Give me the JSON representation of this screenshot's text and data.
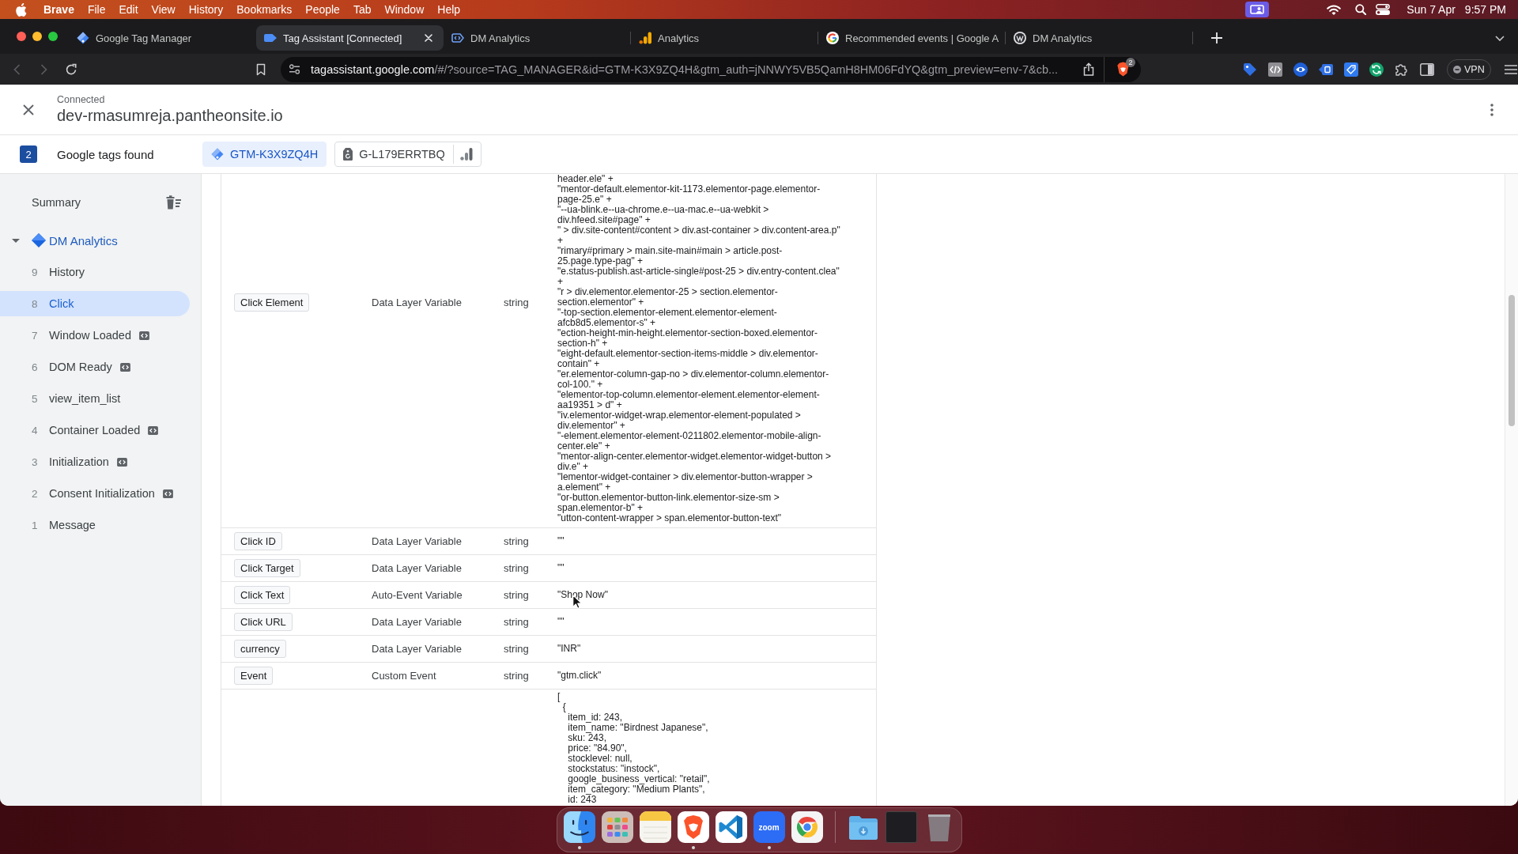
{
  "menu_bar": {
    "app_name": "Brave",
    "menus": [
      "File",
      "Edit",
      "View",
      "History",
      "Bookmarks",
      "People",
      "Tab",
      "Window",
      "Help"
    ],
    "date": "Sun 7 Apr",
    "time": "9:57 PM"
  },
  "browser": {
    "tabs": [
      {
        "title": "Google Tag Manager",
        "kind": "gtm",
        "selected": false
      },
      {
        "title": "Tag Assistant [Connected]",
        "kind": "tag_assistant",
        "selected": true
      },
      {
        "title": "DM Analytics",
        "kind": "tag_outline",
        "selected": false
      },
      {
        "title": "Analytics",
        "kind": "analytics",
        "selected": false
      },
      {
        "title": "Recommended events | Google A",
        "kind": "google",
        "selected": false
      },
      {
        "title": "DM Analytics",
        "kind": "wordpress",
        "selected": false
      }
    ],
    "address_bar": {
      "host": "tagassistant.google.com",
      "path": "/#/?source=TAG_MANAGER&id=GTM-K3X9ZQ4H&gtm_auth=jNNWY5VB5QamH8HM06FdYQ&gtm_preview=env-7&cb..."
    },
    "shields_badge": "2",
    "vpn_label": "VPN"
  },
  "header": {
    "status": "Connected",
    "domain": "dev-rmasumreja.pantheonsite.io"
  },
  "tags_bar": {
    "count": "2",
    "label": "Google tags found",
    "tags": [
      {
        "id": "GTM-K3X9ZQ4H",
        "kind": "gtm",
        "selected": true
      },
      {
        "id": "G-L179ERRTBQ",
        "kind": "ga4",
        "selected": false
      }
    ]
  },
  "sidebar": {
    "summary": "Summary",
    "container": {
      "name": "DM Analytics",
      "expanded": true,
      "children": [
        {
          "number": "9",
          "label": "History",
          "selected": false,
          "code_badge": false
        },
        {
          "number": "8",
          "label": "Click",
          "selected": true,
          "code_badge": false
        },
        {
          "number": "7",
          "label": "Window Loaded",
          "selected": false,
          "code_badge": true
        },
        {
          "number": "6",
          "label": "DOM Ready",
          "selected": false,
          "code_badge": true
        },
        {
          "number": "5",
          "label": "view_item_list",
          "selected": false,
          "code_badge": false
        },
        {
          "number": "4",
          "label": "Container Loaded",
          "selected": false,
          "code_badge": true
        },
        {
          "number": "3",
          "label": "Initialization",
          "selected": false,
          "code_badge": true
        },
        {
          "number": "2",
          "label": "Consent Initialization",
          "selected": false,
          "code_badge": true
        },
        {
          "number": "1",
          "label": "Message",
          "selected": false,
          "code_badge": false
        }
      ]
    }
  },
  "variables_table": {
    "rows": [
      {
        "name": "Click Element",
        "type": "Data Layer Variable",
        "data_type": "string",
        "value": "header.ele\" +\n\"mentor-default.elementor-kit-1173.elementor-page.elementor-\npage-25.e\" +\n\"--ua-blink.e--ua-chrome.e--ua-mac.e--ua-webkit >\ndiv.hfeed.site#page\" +\n\" > div.site-content#content > div.ast-container > div.content-area.p\"\n+\n\"rimary#primary > main.site-main#main > article.post-\n25.page.type-pag\" +\n\"e.status-publish.ast-article-single#post-25 > div.entry-content.clea\"\n+\n\"r > div.elementor.elementor-25 > section.elementor-\nsection.elementor\" +\n\"-top-section.elementor-element.elementor-element-\nafcb8d5.elementor-s\" +\n\"ection-height-min-height.elementor-section-boxed.elementor-\nsection-h\" +\n\"eight-default.elementor-section-items-middle > div.elementor-\ncontain\" +\n\"er.elementor-column-gap-no > div.elementor-column.elementor-\ncol-100.\" +\n\"elementor-top-column.elementor-element.elementor-element-\naa19351 > d\" +\n\"iv.elementor-widget-wrap.elementor-element-populated >\ndiv.elementor\" +\n\"-element.elementor-element-0211802.elementor-mobile-align-\ncenter.ele\" +\n\"mentor-align-center.elementor-widget.elementor-widget-button >\ndiv.e\" +\n\"lementor-widget-container > div.elementor-button-wrapper >\na.element\" +\n\"or-button.elementor-button-link.elementor-size-sm >\nspan.elementor-b\" +\n\"utton-content-wrapper > span.elementor-button-text\""
      },
      {
        "name": "Click ID",
        "type": "Data Layer Variable",
        "data_type": "string",
        "value": "\"\""
      },
      {
        "name": "Click Target",
        "type": "Data Layer Variable",
        "data_type": "string",
        "value": "\"\""
      },
      {
        "name": "Click Text",
        "type": "Auto-Event Variable",
        "data_type": "string",
        "value": "\"Shop Now\""
      },
      {
        "name": "Click URL",
        "type": "Data Layer Variable",
        "data_type": "string",
        "value": "\"\""
      },
      {
        "name": "currency",
        "type": "Data Layer Variable",
        "data_type": "string",
        "value": "\"INR\""
      },
      {
        "name": "Event",
        "type": "Custom Event",
        "data_type": "string",
        "value": "\"gtm.click\""
      },
      {
        "value": "[\n  {\n    item_id: 243,\n    item_name: \"Birdnest Japanese\",\n    sku: 243,\n    price: \"84.90\",\n    stocklevel: null,\n    stockstatus: \"instock\",\n    google_business_vertical: \"retail\",\n    item_category: \"Medium Plants\",\n    id: 243"
      }
    ]
  },
  "dock": {
    "apps": [
      {
        "kind": "finder",
        "running": true
      },
      {
        "kind": "launchpad",
        "running": false
      },
      {
        "kind": "notes",
        "running": false
      },
      {
        "kind": "brave",
        "running": true
      },
      {
        "kind": "vscode",
        "running": false
      },
      {
        "kind": "zoom",
        "text": "zoom",
        "running": true
      },
      {
        "kind": "chrome",
        "running": false
      }
    ],
    "stacks": [
      {
        "kind": "downloads"
      },
      {
        "kind": "screenshot"
      },
      {
        "kind": "trash"
      }
    ]
  }
}
